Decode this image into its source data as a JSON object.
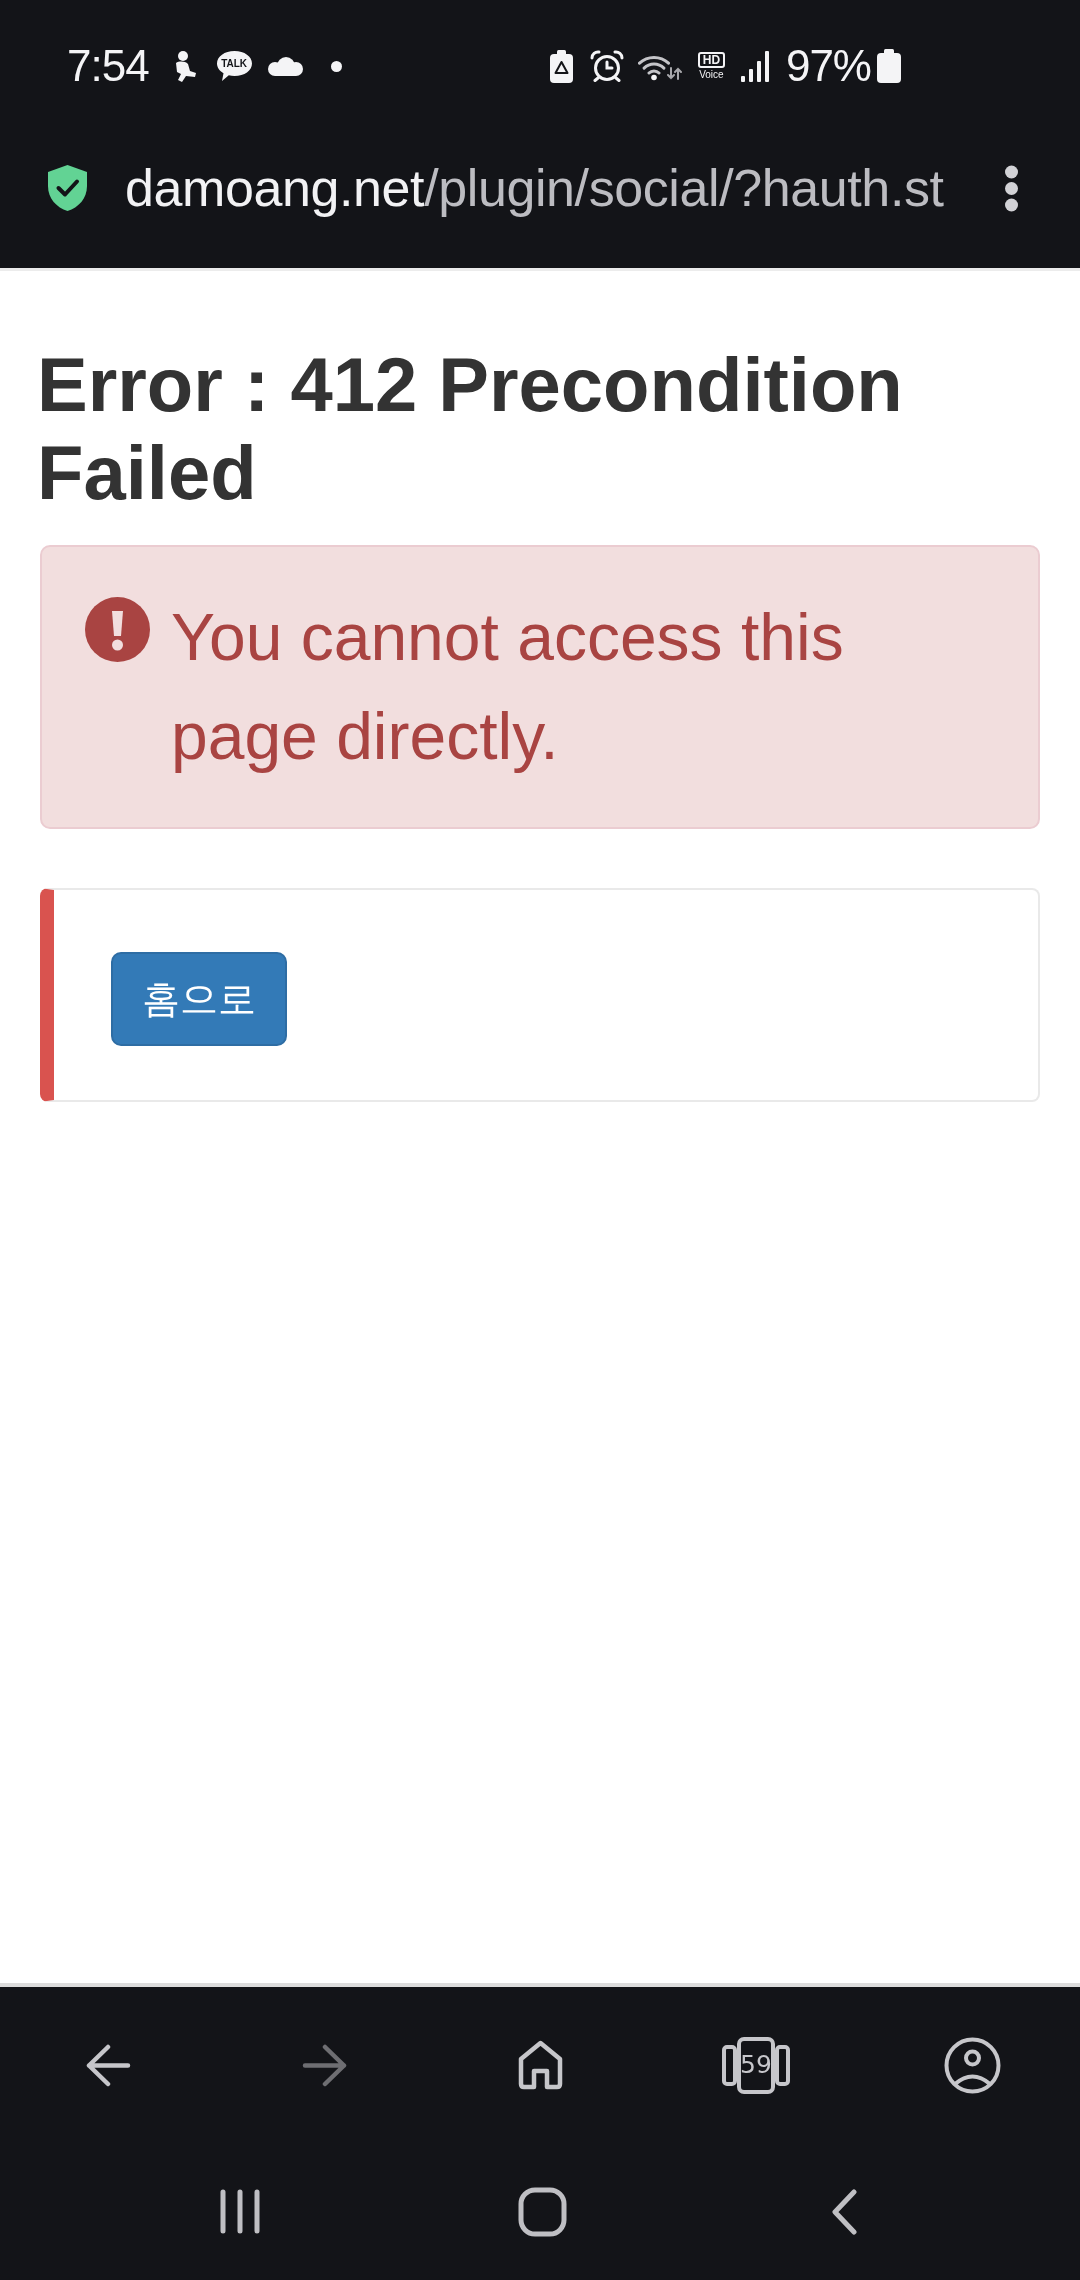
{
  "status_bar": {
    "time": "7:54",
    "chat_badge": "TALK",
    "hd_label": "HD",
    "voice_label": "Voice",
    "battery_percent": "97%"
  },
  "address_bar": {
    "domain": "damoang.net",
    "path": "/plugin/social/?hauth.st"
  },
  "page": {
    "heading": "Error : 412 Precondition Failed",
    "alert_message": "You cannot access this page directly.",
    "home_button": "홈으로"
  },
  "browser_toolbar": {
    "items": [
      {
        "kind": "back",
        "disabled": false
      },
      {
        "kind": "forward",
        "disabled": true
      },
      {
        "kind": "home",
        "disabled": false
      },
      {
        "kind": "tabs",
        "count": "59",
        "disabled": false
      },
      {
        "kind": "profile",
        "disabled": false
      }
    ]
  },
  "nav_bar": {
    "items": [
      {
        "kind": "recents"
      },
      {
        "kind": "home"
      },
      {
        "kind": "back"
      }
    ]
  }
}
